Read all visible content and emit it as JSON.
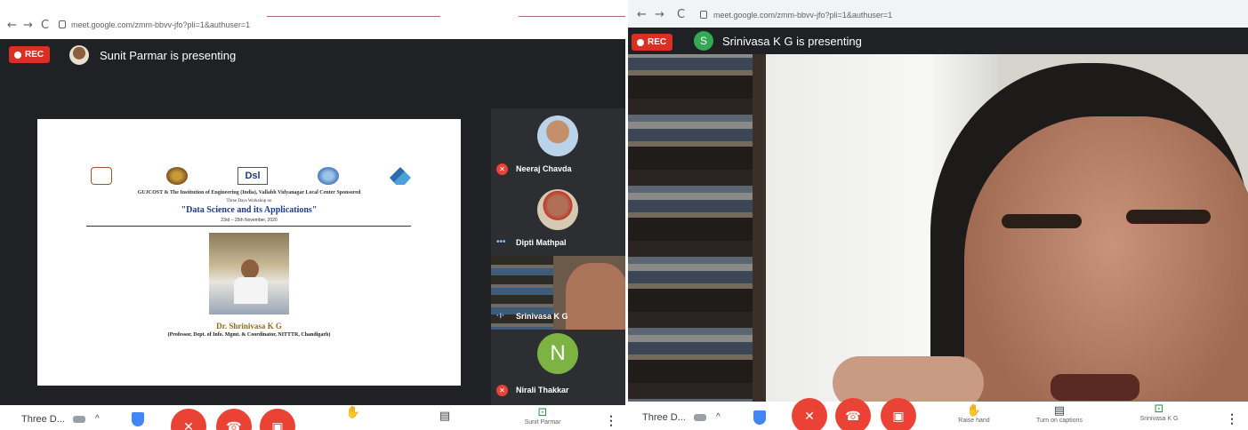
{
  "left": {
    "nav": {
      "back": "←",
      "forward": "→",
      "reload": "C"
    },
    "url": "meet.google.com/zmm-bbvv-jfo?pli=1&authuser=1",
    "rec_label": "REC",
    "presenting_text": "Sunit Parmar is presenting",
    "slide": {
      "line1": "GUJCOST & The Institution of Engineering (India), Vallabh Vidyanagar Local Center Sponsored",
      "line2": "Three Days Workshop on",
      "title": "\"Data Science and its Applications\"",
      "dates": "23rd – 25th November, 2020",
      "speaker": "Dr. Shrinivasa K G",
      "affiliation": "(Professor, Dept. of Info. Mgmt. & Coordinator, NITTTR, Chandigarh)",
      "logo_center": "Dsl"
    },
    "participants": [
      {
        "name": "Neeraj Chavda",
        "status": "muted"
      },
      {
        "name": "Dipti Mathpal",
        "status": "speaking"
      },
      {
        "name": "Srinivasa K G",
        "status": "speaking"
      },
      {
        "name": "Nirali Thakkar",
        "status": "muted",
        "initial": "N"
      }
    ],
    "bottom": {
      "meeting_title": "Three D...",
      "presenter_label": "Sunit Parmar",
      "more": "⋮"
    }
  },
  "right": {
    "nav": {
      "back": "←",
      "forward": "→",
      "reload": "C"
    },
    "url": "meet.google.com/zmm-bbvv-jfo?pli=1&authuser=1",
    "rec_label": "REC",
    "presenter_initial": "S",
    "presenting_text": "Srinivasa K G is presenting",
    "bottom": {
      "meeting_title": "Three D...",
      "raise_hand": "Raise hand",
      "captions": "Turn on captions",
      "presenter_label": "Srinivasa K G",
      "more": "⋮"
    }
  },
  "colors": {
    "rec": "#d93025",
    "end_call": "#ea4335",
    "nirali_avatar": "#7cb342",
    "presenter_s": "#34a853"
  }
}
